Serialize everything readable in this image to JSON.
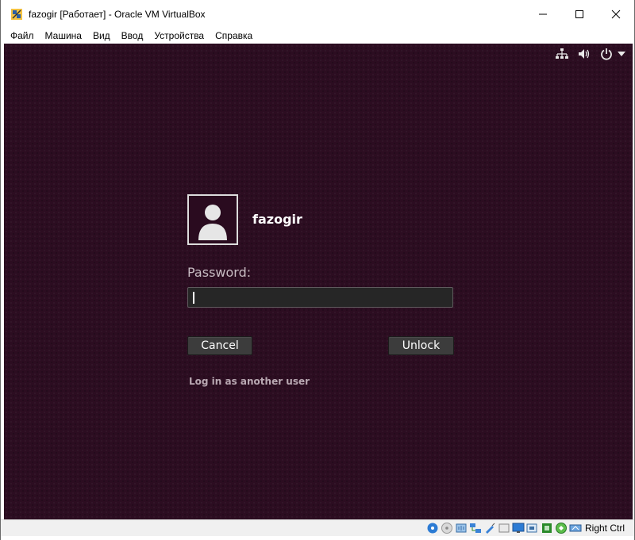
{
  "window": {
    "title": "fazogir [Работает] - Oracle VM VirtualBox",
    "controls": [
      "minimize-icon",
      "maximize-icon",
      "close-icon"
    ]
  },
  "menubar": {
    "items": [
      "Файл",
      "Машина",
      "Вид",
      "Ввод",
      "Устройства",
      "Справка"
    ]
  },
  "guest": {
    "tray_icons": [
      "network-icon",
      "volume-icon",
      "power-icon",
      "dropdown-arrow-icon"
    ],
    "lock_screen": {
      "username": "fazogir",
      "password_label": "Password:",
      "password_value": "",
      "cancel_label": "Cancel",
      "unlock_label": "Unlock",
      "another_user_label": "Log in as another user"
    },
    "background_color": "#2c0d21"
  },
  "statusbar": {
    "icons": [
      "hdd-icon",
      "optical-icon",
      "audio-icon",
      "network-adapter-icon",
      "usb-icon",
      "shared-folders-icon",
      "display-icon",
      "recording-icon",
      "cpu-icon",
      "mouse-integration-icon",
      "keyboard-icon"
    ],
    "host_key": "Right Ctrl"
  }
}
